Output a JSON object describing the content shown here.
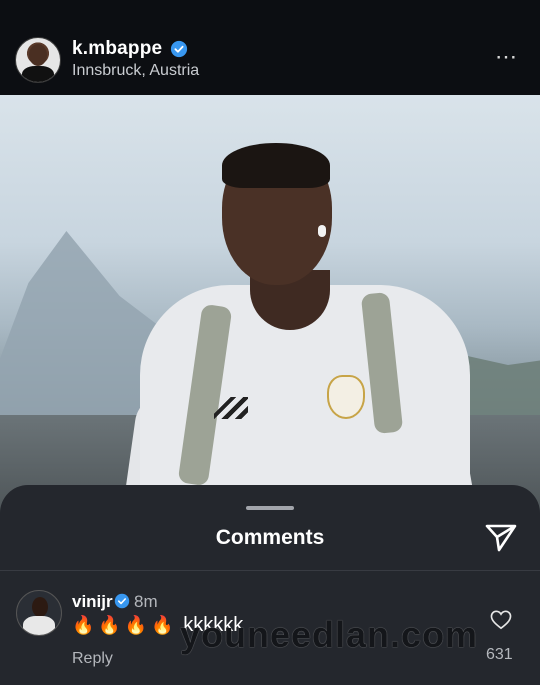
{
  "post": {
    "username": "k.mbappe",
    "location": "Innsbruck, Austria",
    "more_icon": "⋯"
  },
  "comments_sheet": {
    "title": "Comments"
  },
  "comment": {
    "username": "vinijr",
    "time": "8m",
    "emojis": "🔥🔥🔥🔥",
    "text": "kkkkkk",
    "reply_label": "Reply",
    "likes": "631"
  },
  "watermark": "youneedlan.com",
  "colors": {
    "verified": "#3897f0",
    "background": "#0c0e12",
    "sheet": "#24272d"
  }
}
